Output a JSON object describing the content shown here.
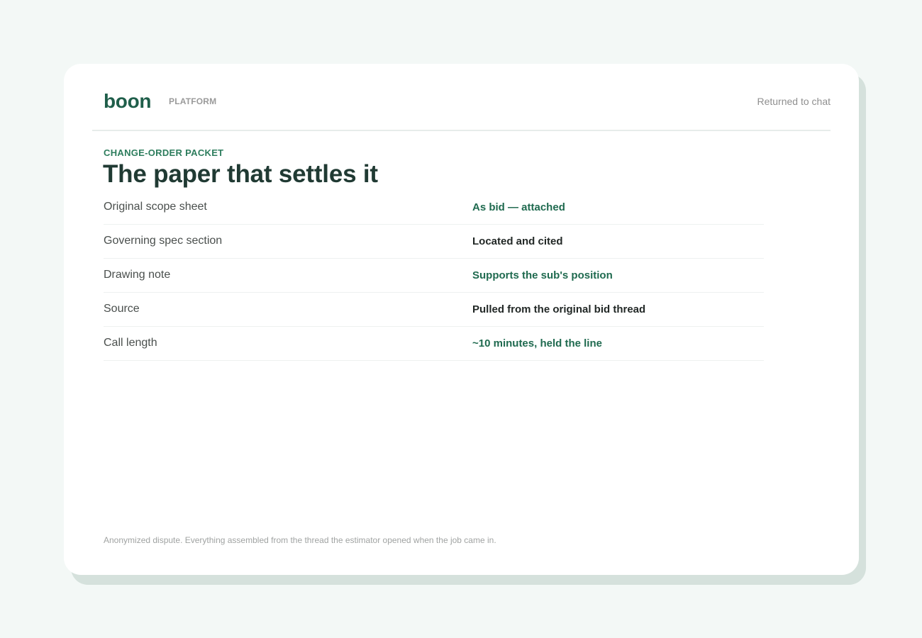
{
  "header": {
    "logo": "boon",
    "section": "PLATFORM",
    "status": "Returned to chat"
  },
  "packet": {
    "eyebrow": "CHANGE-ORDER PACKET",
    "title": "The paper that settles it",
    "rows": [
      {
        "label": "Original scope sheet",
        "value": "As bid — attached",
        "tone": "accent"
      },
      {
        "label": "Governing spec section",
        "value": "Located and cited",
        "tone": "dark"
      },
      {
        "label": "Drawing note",
        "value": "Supports the sub's position",
        "tone": "accent"
      },
      {
        "label": "Source",
        "value": "Pulled from the original bid thread",
        "tone": "dark"
      },
      {
        "label": "Call length",
        "value": "~10 minutes, held the line",
        "tone": "accent"
      }
    ]
  },
  "footnote": "Anonymized dispute. Everything assembled from the thread the estimator opened when the job came in.",
  "colors": {
    "background": "#f3f8f6",
    "brand_green": "#1f5e4a",
    "accent_value": "#1f6a4f",
    "dark_value": "#222826",
    "card_shadow": "#d5e1dc"
  }
}
